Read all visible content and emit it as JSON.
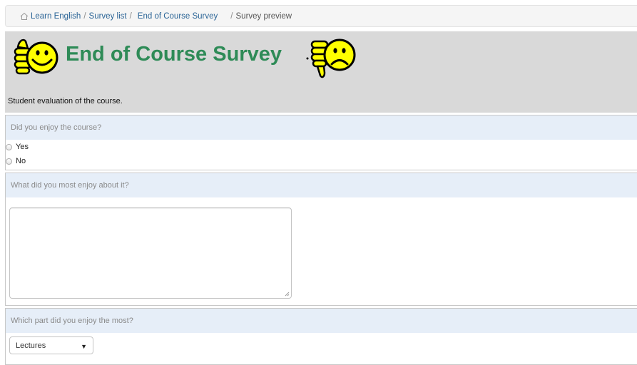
{
  "breadcrumb": {
    "items": [
      "Learn English",
      "Survey list",
      "End of Course Survey",
      "Survey preview"
    ],
    "separator": "/"
  },
  "banner": {
    "title": "End of Course Survey",
    "description": "Student evaluation of the course.",
    "left_icon": "thumbs-up-smiley-icon",
    "right_icon": "thumbs-down-frown-icon"
  },
  "questions": [
    {
      "label": "Did you enjoy the course?",
      "type": "radio",
      "options": [
        "Yes",
        "No"
      ]
    },
    {
      "label": "What did you most enjoy about it?",
      "type": "textarea",
      "value": ""
    },
    {
      "label": "Which part did you enjoy the most?",
      "type": "select",
      "selected": "Lectures"
    }
  ],
  "colors": {
    "title": "#2e8b57",
    "banner_bg": "#d9d9d9",
    "question_header_bg": "#e6eef8",
    "link": "#2a6496",
    "icon_yellow": "#ffff00"
  }
}
